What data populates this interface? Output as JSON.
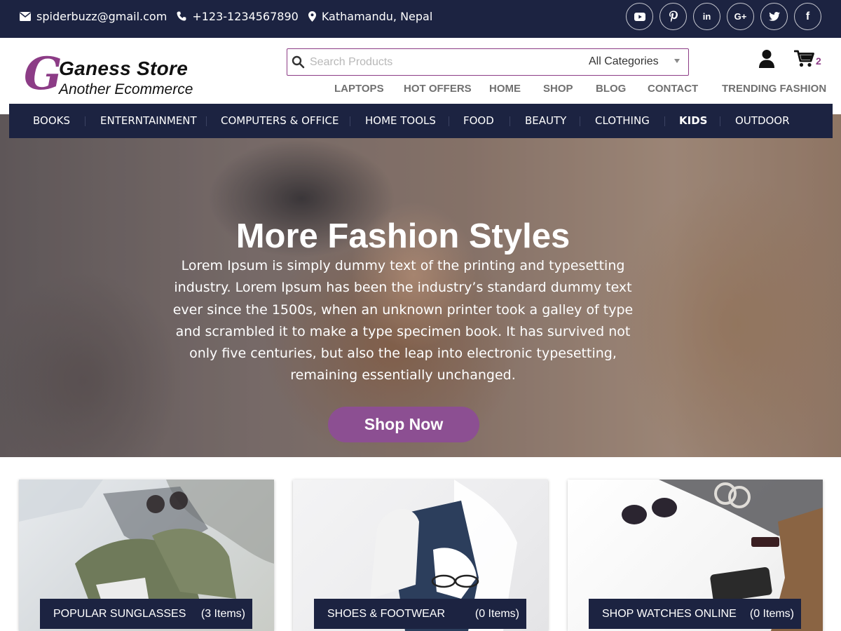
{
  "topbar": {
    "email": "spiderbuzz@gmail.com",
    "phone": "+123-1234567890",
    "location": "Kathamandu, Nepal",
    "socials": [
      "youtube-icon",
      "pinterest-icon",
      "linkedin-icon",
      "google-plus-icon",
      "twitter-icon",
      "facebook-icon"
    ],
    "social_glyphs": {
      "linkedin": "in",
      "google": "G+",
      "facebook": "f"
    }
  },
  "header": {
    "logo_letter": "G",
    "logo_name": "Ganess Store",
    "logo_tagline": "Another Ecommerce",
    "search_placeholder": "Search Products",
    "category_select": "All Categories",
    "cart_count": "2",
    "nav": [
      "LAPTOPS",
      "HOT OFFERS",
      "HOME",
      "SHOP",
      "BLOG",
      "CONTACT",
      "TRENDING FASHION"
    ]
  },
  "category_bar": {
    "items": [
      "BOOKS",
      "ENTERNTAINMENT",
      "COMPUTERS & OFFICE",
      "HOME TOOLS",
      "FOOD",
      "BEAUTY",
      "CLOTHING",
      "KIDS",
      "OUTDOOR"
    ],
    "active": "KIDS"
  },
  "hero": {
    "title": "More Fashion Styles",
    "text": "Lorem Ipsum is simply dummy text of the printing and typesetting industry. Lorem Ipsum has been the industry’s standard dummy text ever since the 1500s, when an unknown printer took a galley of type and scrambled it to make a type specimen book. It has survived not only five centuries, but also the leap into electronic typesetting, remaining essentially unchanged.",
    "button": "Shop Now"
  },
  "cards": [
    {
      "title": "POPULAR SUNGLASSES",
      "count": "(3 Items)"
    },
    {
      "title": "SHOES & FOOTWEAR",
      "count": "(0 Items)"
    },
    {
      "title": "SHOP WATCHES ONLINE",
      "count": "(0 Items)"
    }
  ],
  "colors": {
    "navy": "#1c2341",
    "accent": "#8c3c86",
    "button": "#8c4f92"
  }
}
